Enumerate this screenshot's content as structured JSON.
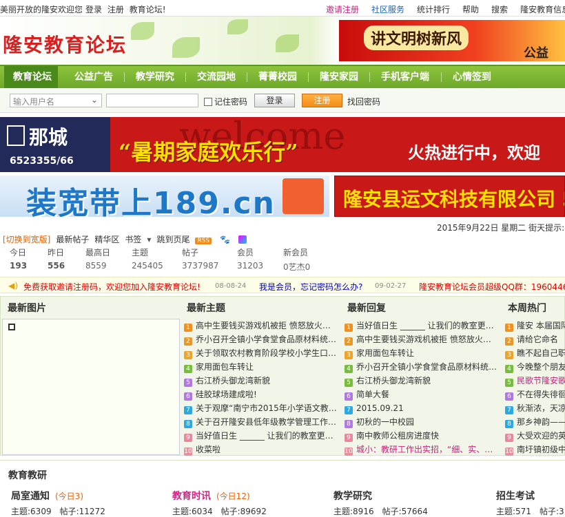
{
  "topbar": {
    "welcome": "美丽开放的隆安欢迎您",
    "login": "登录",
    "register": "注册",
    "forum_greet": "教育论坛!",
    "links": [
      "邀请注册",
      "社区服务",
      "统计排行",
      "帮助",
      "搜索",
      "隆安教育信息网"
    ]
  },
  "header": {
    "logo": "隆安教育论坛",
    "promo_text": "讲文明树新风",
    "promo_sub": "公益"
  },
  "nav": {
    "items": [
      "教育论坛",
      "公益广告",
      "教学研究",
      "交流园地",
      "菁菁校园",
      "隆安家园",
      "手机客户端",
      "心情签到"
    ]
  },
  "login_bar": {
    "username_placeholder": "输入用户名",
    "remember": "记住密码",
    "login_btn": "登录",
    "register_btn": "注册",
    "find_pwd": "找回密码"
  },
  "banners": {
    "b1_brand": "那城",
    "b1_phone": "6523355/66",
    "b1_welcome": "welcome",
    "b1_text": "“暑期家庭欢乐行”",
    "b1_text2": "火热进行中，欢迎",
    "b2_text": "装宽带上189.cn",
    "b3_text": "隆安县运文科技有限公司 5"
  },
  "date_line": "2015年9月22日  星期二  街天提示:",
  "stats_links": [
    "[切换到宽版]",
    "最新帖子",
    "精华区",
    "书签",
    "跳到页尾"
  ],
  "rss": "RSS",
  "stats": [
    {
      "label": "今日",
      "value": "193"
    },
    {
      "label": "昨日",
      "value": "556"
    },
    {
      "label": "最高日",
      "value": "8559"
    },
    {
      "label": "主题",
      "value": "245405"
    },
    {
      "label": "帖子",
      "value": "3737987"
    },
    {
      "label": "会员",
      "value": "31203"
    },
    {
      "label": "新会员",
      "value": "0艺杰0"
    }
  ],
  "notices": [
    {
      "text": "免费获取邀请注册码，欢迎您加入隆安教育论坛!",
      "date": "08-08-24",
      "color": "#e00000"
    },
    {
      "text": "我是会员，忘记密码怎么办?",
      "date": "09-02-27",
      "color": "#0000c0"
    },
    {
      "text": "隆安教育论坛会员超级QQ群：1960446",
      "date": "",
      "color": "#e00000"
    }
  ],
  "panels": {
    "pics_title": "最新图片",
    "topics_title": "最新主题",
    "replies_title": "最新回复",
    "hot_title": "本周热门",
    "topics": [
      "高中生要钱买游戏机被拒 愤怒放火…",
      "乔小召开全镇小学食堂食品原材料统…",
      "关于领取农村教育阶段学校小学生口…",
      "家用面包车转让",
      "右江桥头御龙湾新貌",
      "硅胶球场建成啦!",
      "关于观摩“南宁市2015年小学语文教…",
      "关于召开隆安县低年级教学管理工作…",
      "当好值日生 ______ 让我们的教室更…",
      "收菜啦"
    ],
    "replies": [
      "当好值日生 ______ 让我们的教室更…",
      "高中生要钱买游戏机被拒 愤怒放火…",
      "家用面包车转让",
      "乔小召开全镇小学食堂食品原材料统…",
      "右江桥头御龙湾新貌",
      "简单大餐",
      "2015.09.21",
      "初秋的一中校园",
      "南中教师公租房进度快",
      "城小：教研工作出实招，“细、实、…"
    ],
    "hot": [
      "隆安 本届国际…",
      "请给它命名",
      "瞧不起自己职…",
      "今晚整个朋友…",
      "民歌节隆安歌…",
      "不在得失徘徊…",
      "秋渐浓，天凉…",
      "那乡神韵——…",
      "大受欢迎的英…",
      "南圩镇初级中…"
    ]
  },
  "edu": {
    "title": "教育教研",
    "forums": [
      {
        "name": "局室通知",
        "today": "(今日3)",
        "topics": "主题:6309",
        "posts": "帖子:11272",
        "color": "#222"
      },
      {
        "name": "教育时讯",
        "today": "(今日12)",
        "topics": "主题:6034",
        "posts": "帖子:89692",
        "color": "#d8208a"
      },
      {
        "name": "教学研究",
        "today": "",
        "topics": "主题:8916",
        "posts": "帖子:57664",
        "color": "#222"
      },
      {
        "name": "招生考试",
        "today": "",
        "topics": "主题:571",
        "posts": "帖子:3",
        "color": "#222"
      }
    ]
  },
  "colors": {
    "accent_green": "#7ab532",
    "orange": "#f48c18",
    "red": "#d82020"
  }
}
